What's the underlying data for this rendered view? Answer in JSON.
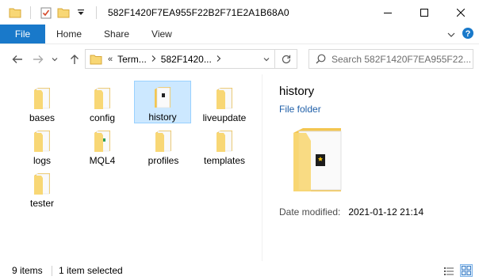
{
  "window": {
    "title": "582F1420F7EA955F22B2F71E2A1B68A0"
  },
  "ribbon": {
    "tabs": [
      {
        "label": "File"
      },
      {
        "label": "Home"
      },
      {
        "label": "Share"
      },
      {
        "label": "View"
      }
    ]
  },
  "address": {
    "overflow_glyph": "«",
    "crumbs": [
      "Term...",
      "582F1420..."
    ]
  },
  "search": {
    "placeholder": "Search 582F1420F7EA955F22..."
  },
  "items": [
    {
      "label": "bases",
      "icon": "folder-icon"
    },
    {
      "label": "config",
      "icon": "folder-icon"
    },
    {
      "label": "history",
      "icon": "folder-icon",
      "selected": true
    },
    {
      "label": "liveupdate",
      "icon": "folder-icon"
    },
    {
      "label": "logs",
      "icon": "folder-icon"
    },
    {
      "label": "MQL4",
      "icon": "folder-icon"
    },
    {
      "label": "profiles",
      "icon": "folder-icon"
    },
    {
      "label": "templates",
      "icon": "folder-icon"
    },
    {
      "label": "tester",
      "icon": "folder-icon"
    }
  ],
  "preview": {
    "name": "history",
    "type": "File folder",
    "date_label": "Date modified:",
    "date_value": "2021-01-12 21:14"
  },
  "status": {
    "count": "9 items",
    "selection": "1 item selected"
  },
  "colors": {
    "accent": "#1979ca",
    "selection_bg": "#cce8ff",
    "selection_border": "#99d1ff",
    "folder": "#f8d775"
  }
}
